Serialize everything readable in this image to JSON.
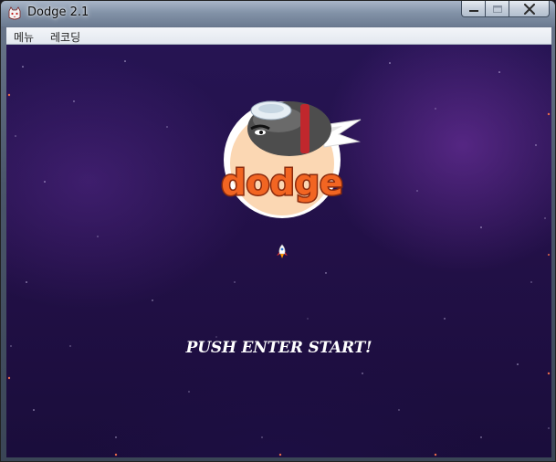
{
  "window": {
    "title": "Dodge 2.1",
    "app_icon": "cat-icon"
  },
  "caption": {
    "minimize_icon": "minimize-icon",
    "maximize_icon": "maximize-icon",
    "close_icon": "close-icon"
  },
  "menu": {
    "items": [
      {
        "label": "메뉴"
      },
      {
        "label": "레코딩"
      }
    ]
  },
  "game": {
    "logo_text": "dodge",
    "prompt": "PUSH ENTER START!",
    "player_icon": "rocket-ship-icon",
    "colors": {
      "background": "#231150",
      "logo_orange": "#f26522",
      "prompt_text": "#ffffff"
    }
  }
}
